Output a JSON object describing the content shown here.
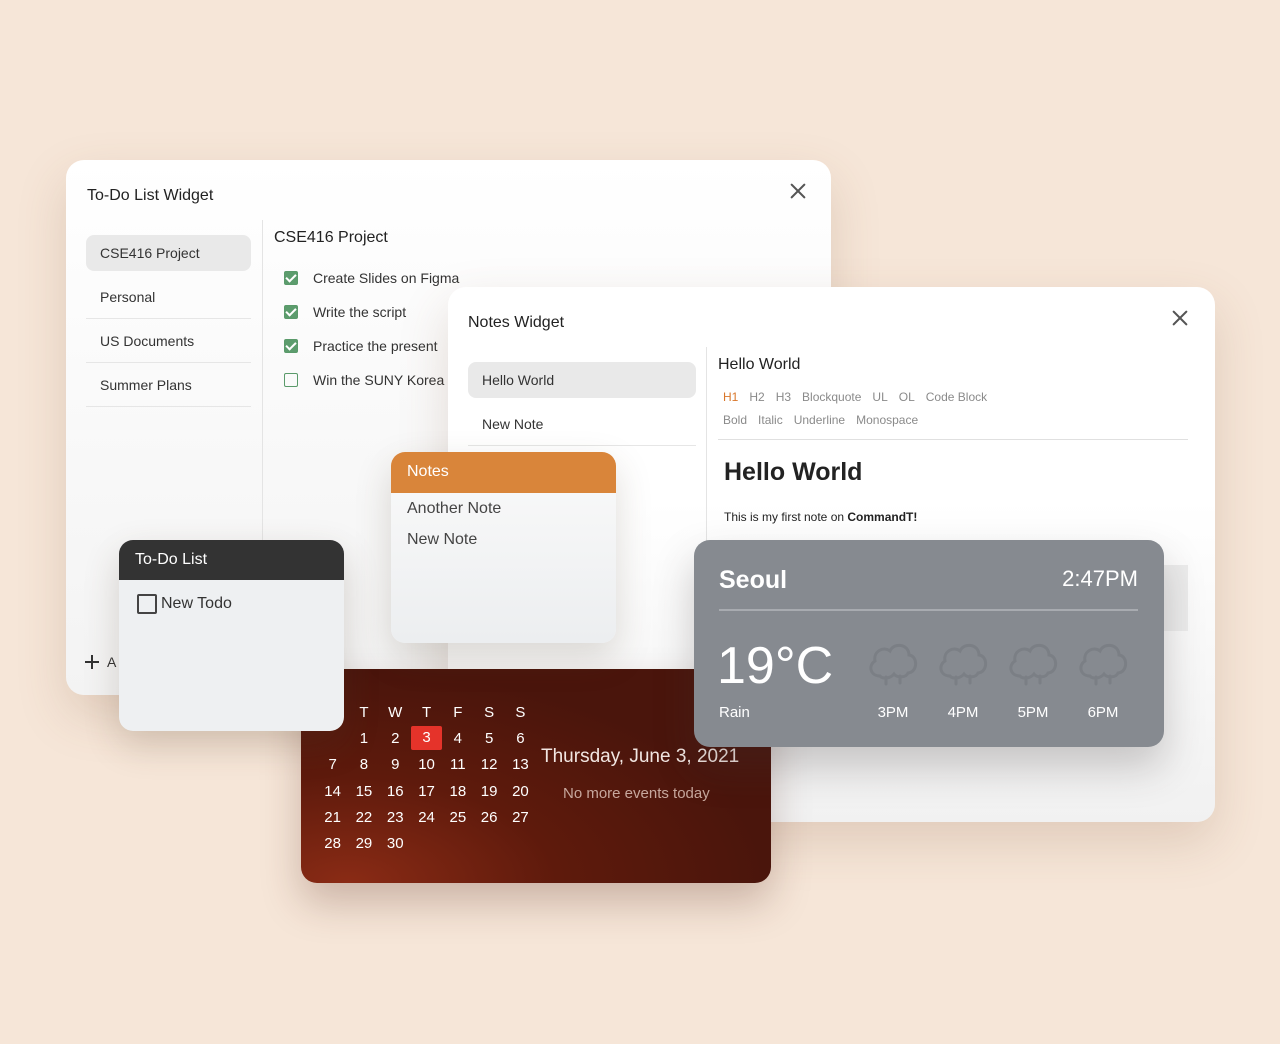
{
  "todo_widget": {
    "title": "To-Do List Widget",
    "lists": [
      "CSE416 Project",
      "Personal",
      "US Documents",
      "Summer Plans"
    ],
    "add_label": "A",
    "current_list": "CSE416 Project",
    "tasks": [
      {
        "label": "Create Slides on Figma",
        "done": true
      },
      {
        "label": "Write the script",
        "done": true
      },
      {
        "label": "Practice the present",
        "done": true
      },
      {
        "label": "Win the SUNY Korea",
        "done": false
      }
    ]
  },
  "notes_widget": {
    "title": "Notes Widget",
    "notes": [
      "Hello World",
      "New Note"
    ],
    "editor_title": "Hello World",
    "toolbar": [
      "H1",
      "H2",
      "H3",
      "Blockquote",
      "UL",
      "OL",
      "Code Block",
      "Bold",
      "Italic",
      "Underline",
      "Monospace"
    ],
    "active_tool": "H1",
    "heading": "Hello World",
    "body_prefix": "This is my first note on ",
    "body_bold": "CommandT!"
  },
  "todo_small": {
    "header": "To-Do List",
    "items": [
      "New Todo"
    ]
  },
  "notes_small": {
    "header": "Notes",
    "items": [
      "Another Note",
      "New Note"
    ]
  },
  "calendar": {
    "weekdays": [
      "T",
      "W",
      "T",
      "F",
      "S",
      "S"
    ],
    "weeks": [
      [
        "",
        "1",
        "2",
        "3",
        "4",
        "5",
        "6"
      ],
      [
        "7",
        "8",
        "9",
        "10",
        "11",
        "12",
        "13"
      ],
      [
        "14",
        "15",
        "16",
        "17",
        "18",
        "19",
        "20"
      ],
      [
        "21",
        "22",
        "23",
        "24",
        "25",
        "26",
        "27"
      ],
      [
        "28",
        "29",
        "30",
        "",
        "",
        "",
        ""
      ]
    ],
    "today": "3",
    "date_label": "Thursday, June 3, 2021",
    "events_label": "No more events today"
  },
  "weather": {
    "city": "Seoul",
    "time": "2:47PM",
    "temperature": "19°C",
    "condition": "Rain",
    "hours": [
      "3PM",
      "4PM",
      "5PM",
      "6PM"
    ],
    "hour_icons": [
      "rain-cloud-icon",
      "rain-cloud-icon",
      "rain-cloud-icon",
      "rain-cloud-icon"
    ]
  },
  "colors": {
    "background": "#f6e6d8",
    "notes_accent": "#d9853a",
    "todo_header": "#333333",
    "check_green": "#5c9c6d",
    "calendar_today": "#e5332a",
    "weather_bg": "#868a90"
  }
}
